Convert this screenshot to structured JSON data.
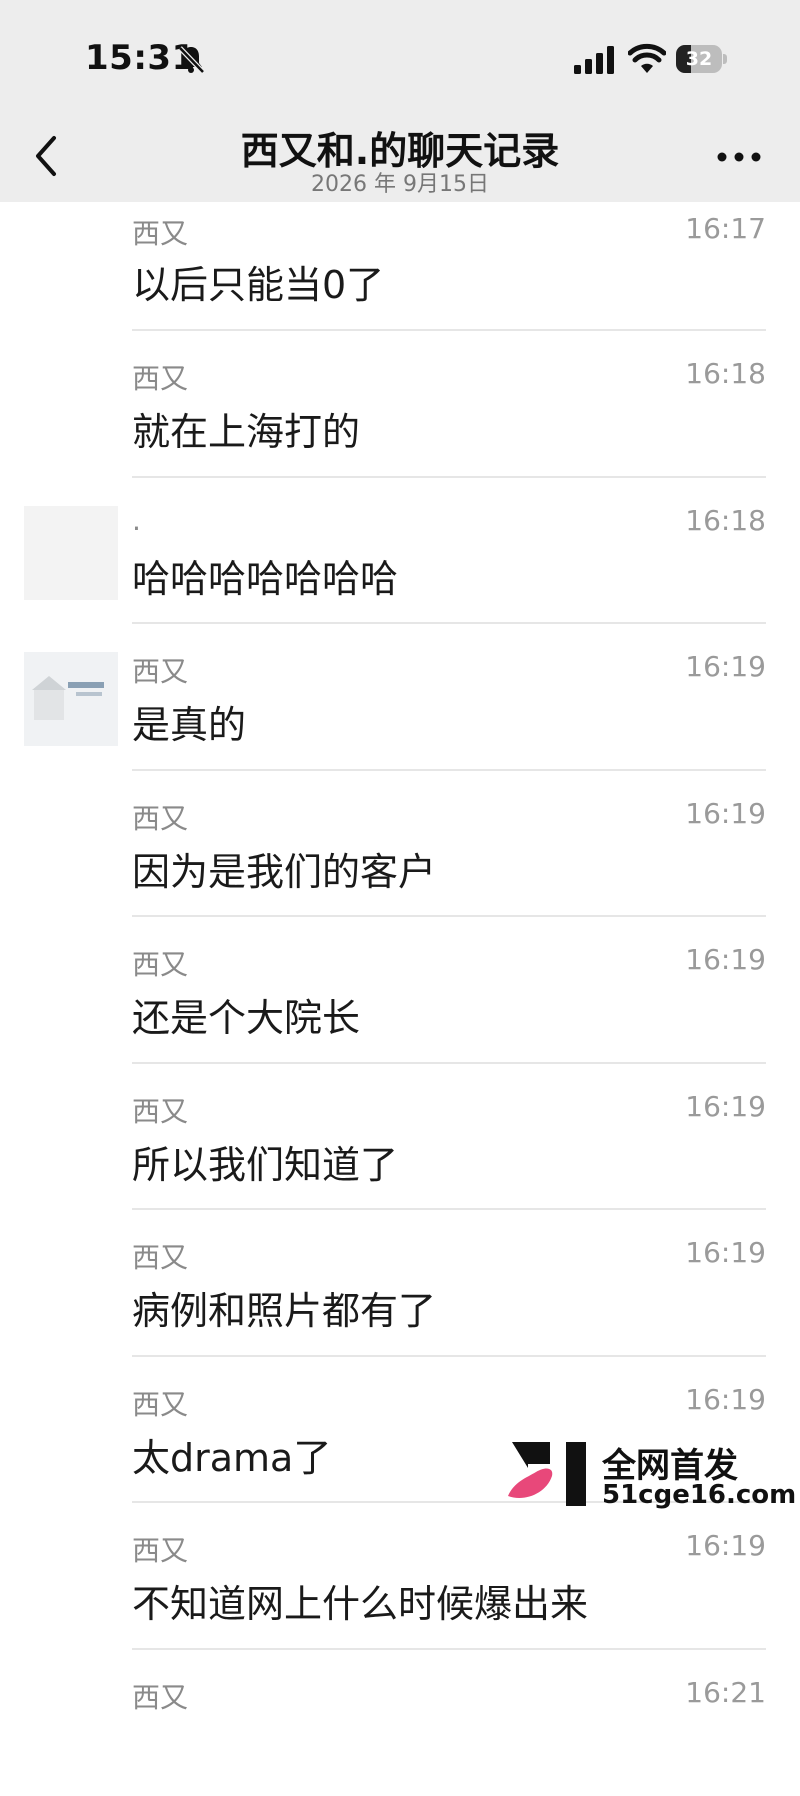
{
  "status_bar": {
    "time": "15:31",
    "battery_level": "32",
    "battery_fraction": 0.32,
    "icons": [
      "bell-muted-icon",
      "cellular-signal-icon",
      "wifi-icon",
      "battery-icon"
    ]
  },
  "nav": {
    "title": "西又和.的聊天记录",
    "subtitle": "2026 年 9月15日",
    "back_icon": "chevron-left-icon",
    "more_icon": "more-dots-icon"
  },
  "messages": [
    {
      "sender": "西又",
      "time": "16:17",
      "text": "以后只能当0了",
      "avatar": "none"
    },
    {
      "sender": "西又",
      "time": "16:18",
      "text": "就在上海打的",
      "avatar": "none"
    },
    {
      "sender": ".",
      "time": "16:18",
      "text": "哈哈哈哈哈哈哈",
      "avatar": "blank"
    },
    {
      "sender": "西又",
      "time": "16:19",
      "text": "是真的",
      "avatar": "image"
    },
    {
      "sender": "西又",
      "time": "16:19",
      "text": "因为是我们的客户",
      "avatar": "none"
    },
    {
      "sender": "西又",
      "time": "16:19",
      "text": "还是个大院长",
      "avatar": "none"
    },
    {
      "sender": "西又",
      "time": "16:19",
      "text": "所以我们知道了",
      "avatar": "none"
    },
    {
      "sender": "西又",
      "time": "16:19",
      "text": "病例和照片都有了",
      "avatar": "none"
    },
    {
      "sender": "西又",
      "time": "16:19",
      "text": "太drama了",
      "avatar": "none"
    },
    {
      "sender": "西又",
      "time": "16:19",
      "text": "不知道网上什么时候爆出来",
      "avatar": "none"
    },
    {
      "sender": "西又",
      "time": "16:21",
      "text": "",
      "avatar": "none"
    }
  ],
  "watermark": {
    "line1": "全网首发",
    "line2": "51cge16.com",
    "colors": {
      "pink": "#e8487a",
      "dark": "#111111"
    }
  },
  "colors": {
    "header_bg": "#ededed",
    "divider": "#e6e6e6",
    "secondary_text": "#8a8a8a"
  }
}
